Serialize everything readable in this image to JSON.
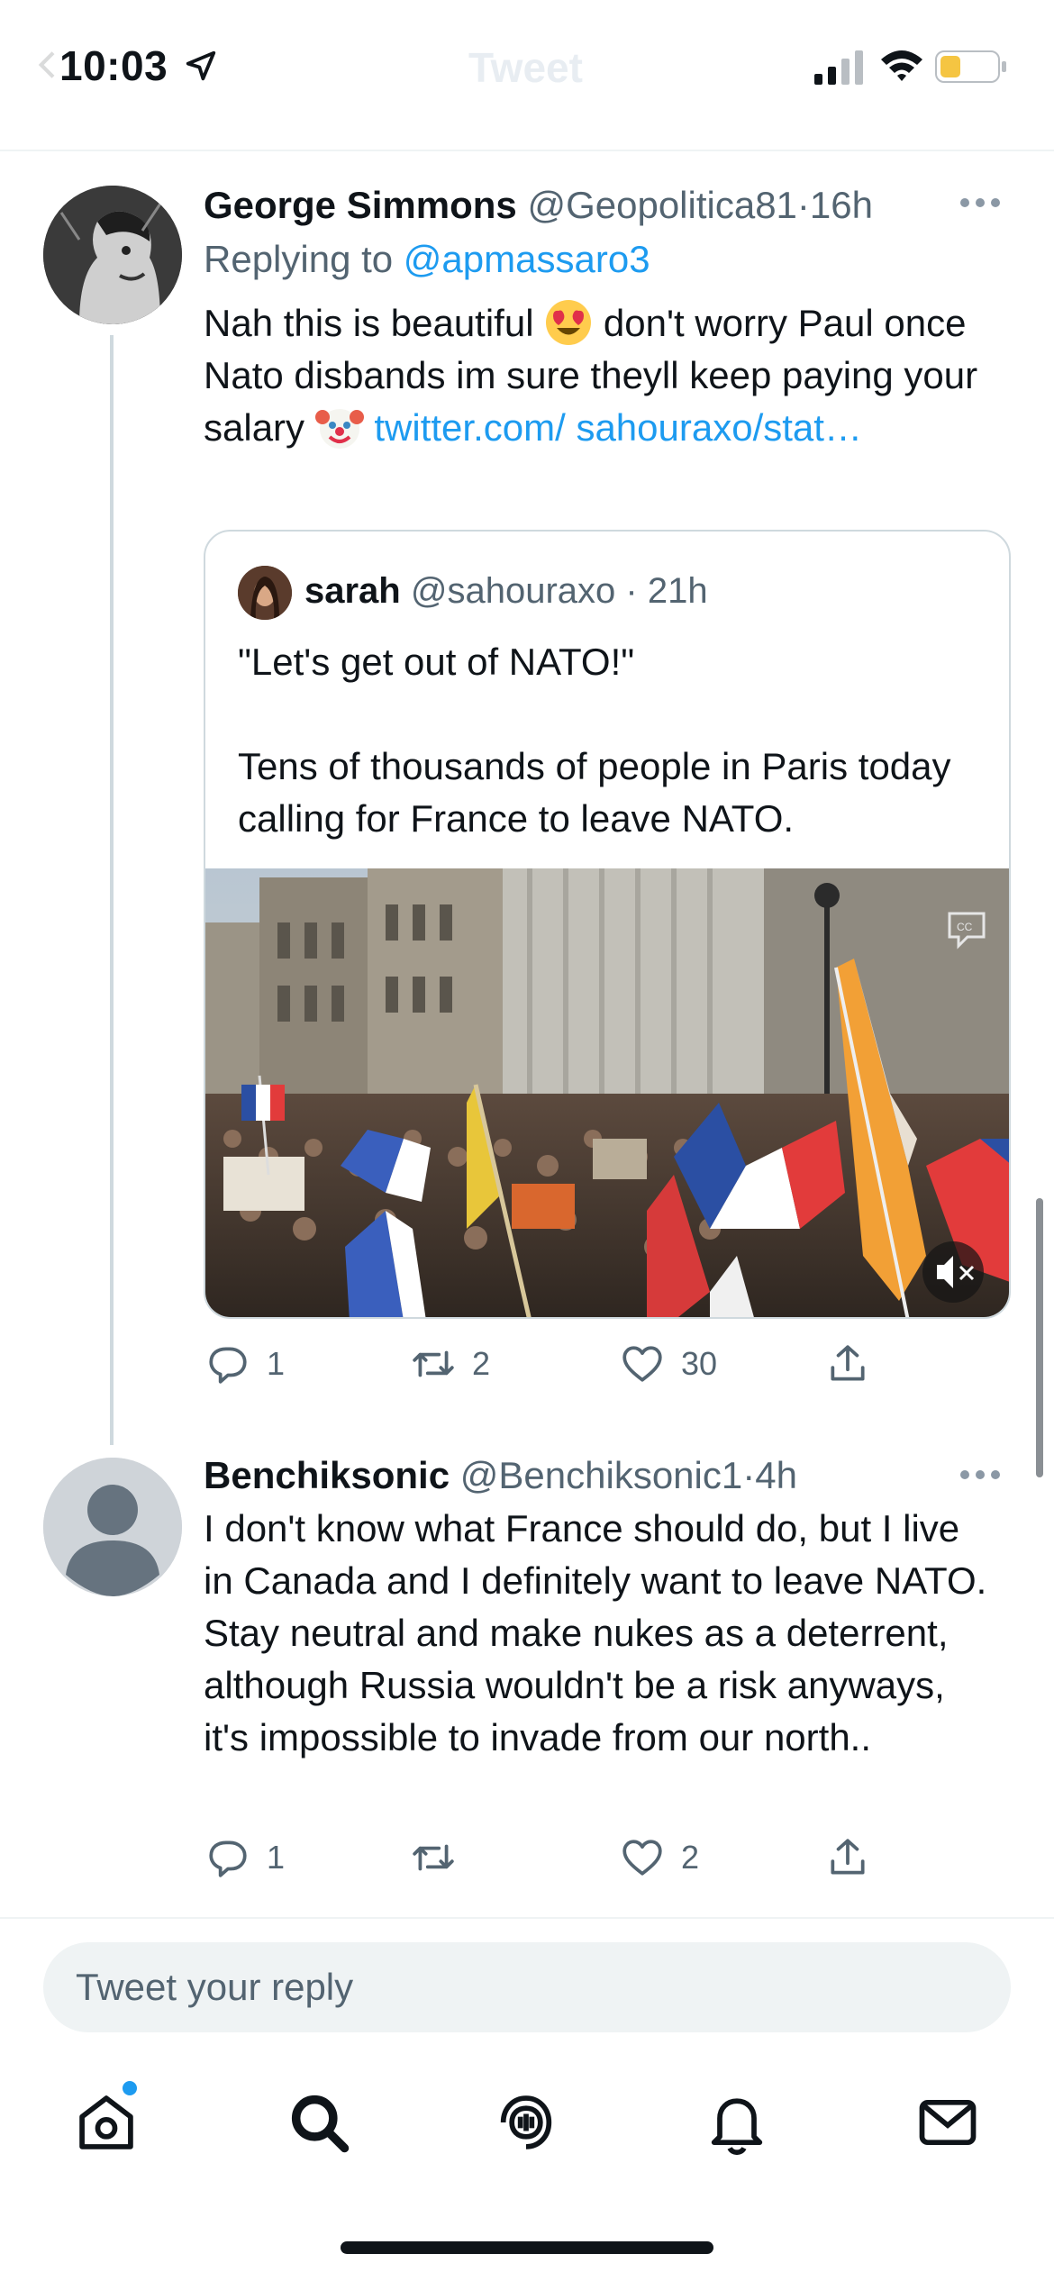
{
  "status_bar": {
    "time": "10:03",
    "faded_title": "Tweet",
    "battery_color": "#f5c542"
  },
  "tweet_1": {
    "name": "George Simmons",
    "handle": "@Geopolitica81",
    "time": "16h",
    "replying_to_label": "Replying to",
    "replying_to_handle": "@apmassaro3",
    "text_1": "Nah this is beautiful",
    "emoji_1": "heart-eyes-emoji",
    "text_2": "don't worry Paul once Nato disbands im sure theyll keep paying your salary",
    "emoji_2": "clown-emoji",
    "link": "twitter.com/ sahouraxo/stat…",
    "quote": {
      "name": "sarah",
      "handle": "@sahouraxo",
      "time": "21h",
      "text": "\"Let's get out of NATO!\"\n\nTens of thousands of people in Paris today calling for France to leave NATO.",
      "media_icons": [
        "closed-captions-icon",
        "mute-icon"
      ]
    },
    "actions": {
      "replies": "1",
      "retweets": "2",
      "likes": "30"
    }
  },
  "tweet_2": {
    "name": "Benchiksonic",
    "handle": "@Benchiksonic1",
    "time": "4h",
    "text": "I don't know what France should do, but I live in Canada and I definitely want to leave NATO. Stay neutral and make nukes as a deterrent, although Russia wouldn't be a risk anyways, it's impossible to invade from our north..",
    "actions": {
      "replies": "1",
      "retweets": "",
      "likes": "2"
    }
  },
  "composer": {
    "placeholder": "Tweet your reply"
  },
  "tab_bar": {
    "tabs": [
      "home-icon",
      "search-icon",
      "spaces-icon",
      "notifications-icon",
      "messages-icon"
    ],
    "accent_color": "#1d9bf0"
  }
}
